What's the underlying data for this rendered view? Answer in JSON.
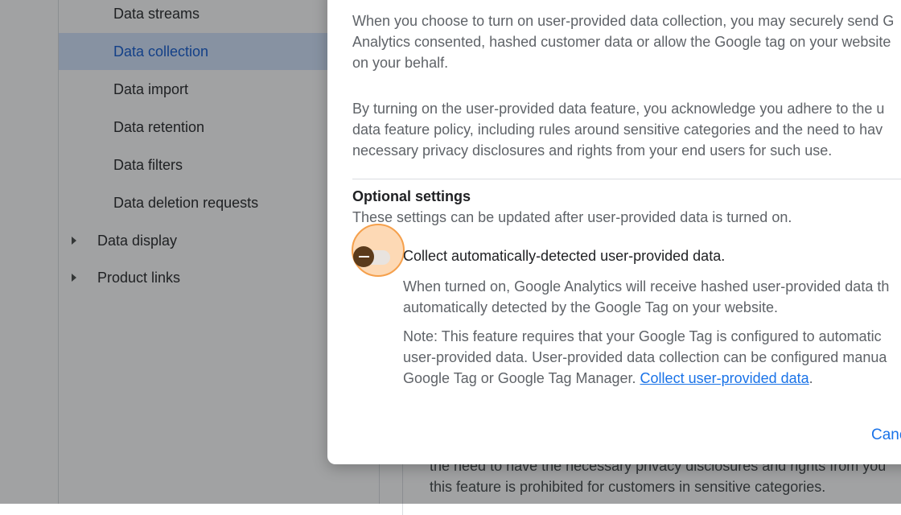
{
  "sidebar": {
    "items": [
      {
        "label": "Data streams"
      },
      {
        "label": "Data collection",
        "active": true
      },
      {
        "label": "Data import"
      },
      {
        "label": "Data retention"
      },
      {
        "label": "Data filters"
      },
      {
        "label": "Data deletion requests"
      }
    ],
    "groups": [
      {
        "label": "Data display"
      },
      {
        "label": "Product links"
      }
    ]
  },
  "background": {
    "text": "the need to have the necessary privacy disclosures and rights from you\nthis feature is prohibited for customers in sensitive categories."
  },
  "dialog": {
    "para1": "When you choose to turn on user-provided data collection, you may securely send G\nAnalytics consented, hashed customer data or allow the Google tag on your website\non your behalf.",
    "para2": "By turning on the user-provided data feature, you acknowledge you adhere to the u\ndata feature policy, including rules around sensitive categories and the need to hav\nnecessary privacy disclosures and rights from your end users for such use.",
    "optional_title": "Optional settings",
    "optional_subtitle": "These settings can be updated after user-provided data is turned on.",
    "toggle_label": "Collect automatically-detected user-provided data.",
    "toggle_state": "off",
    "detail1": "When turned on, Google Analytics will receive hashed user-provided data th\nautomatically detected by the Google Tag on your website.",
    "note_text": "Note: This feature requires that your Google Tag is configured to automatic\nuser-provided data. User-provided data collection can be configured manua\nGoogle Tag or Google Tag Manager. ",
    "note_link": "Collect user-provided data",
    "note_end": ".",
    "cancel_label": "Canc"
  },
  "colors": {
    "accent": "#1a73e8",
    "active_nav_bg": "#d3e3fd",
    "highlight": "#f5a04c",
    "toggle_thumb": "#5b3b1c"
  }
}
